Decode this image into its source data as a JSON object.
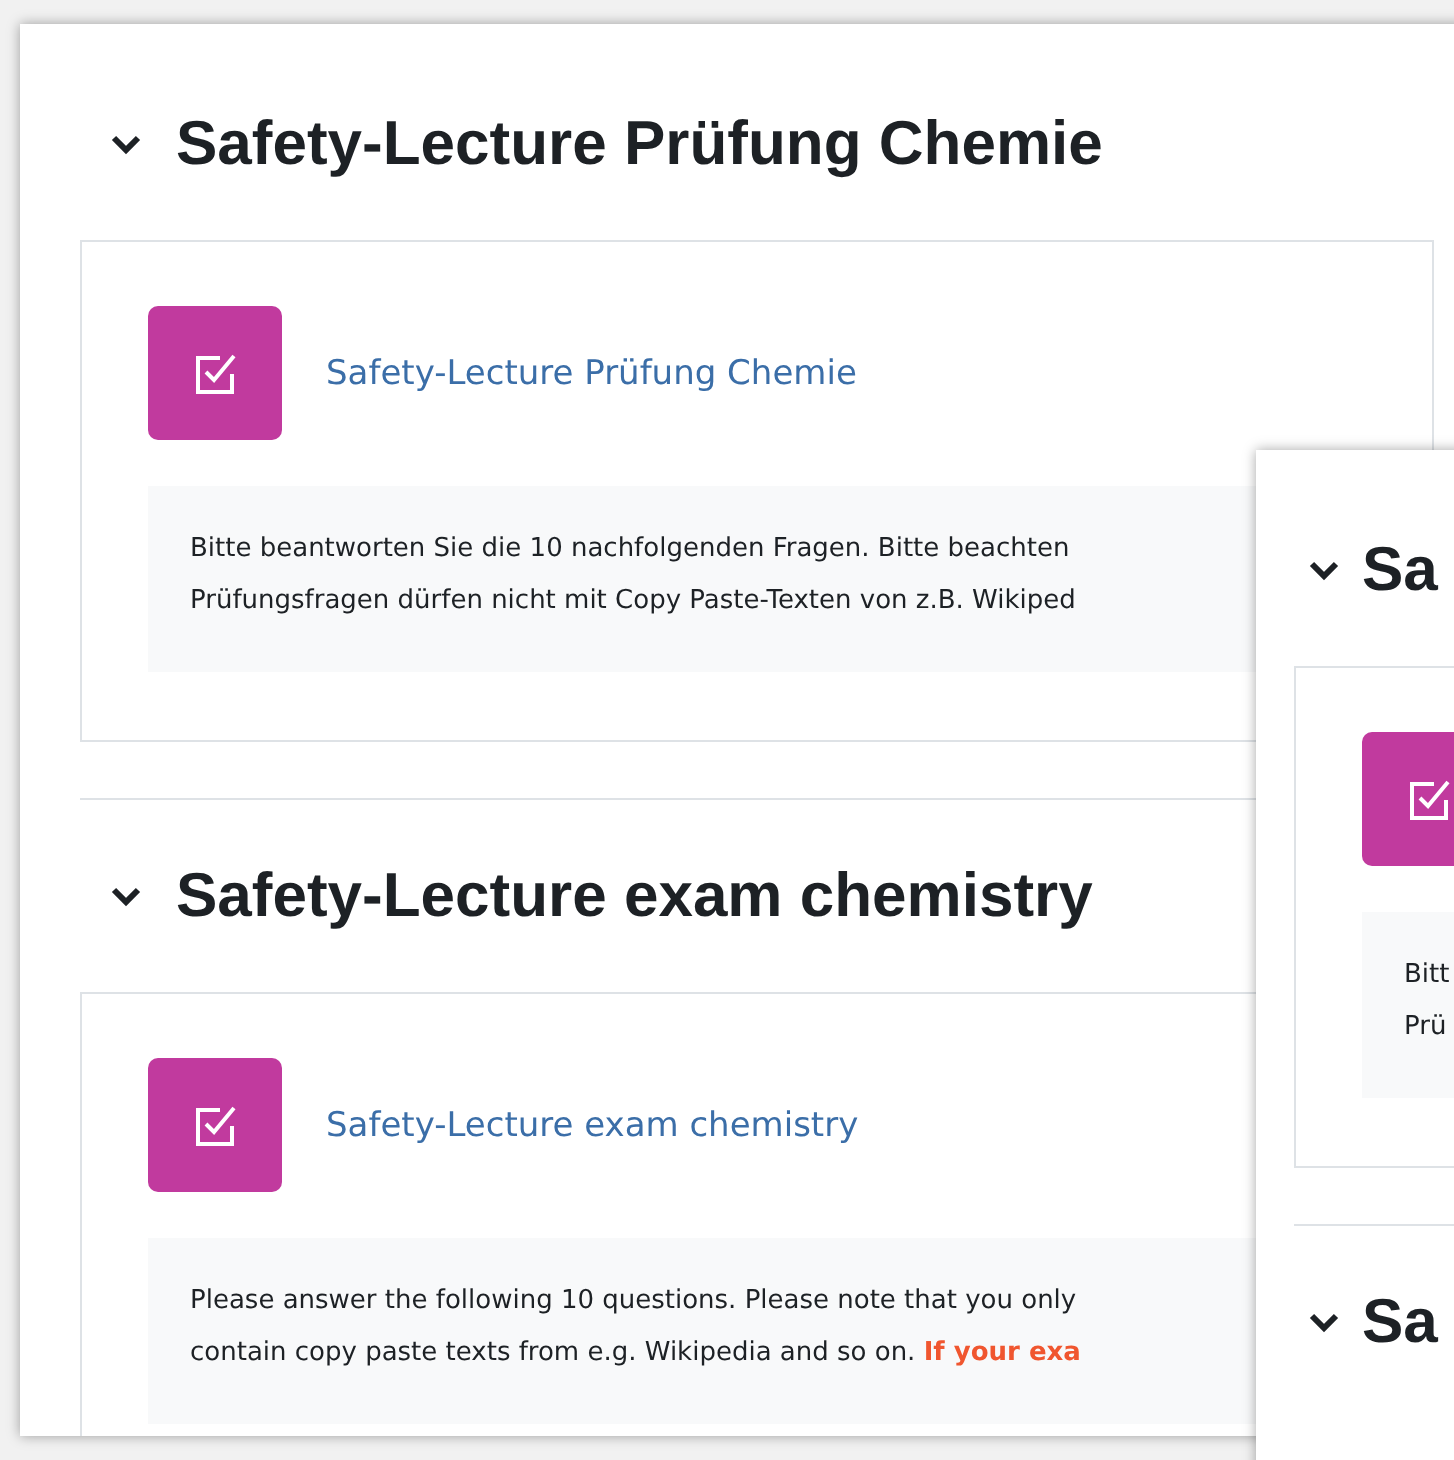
{
  "windows": [
    {
      "sections": [
        {
          "title": "Safety-Lecture Prüfung Chemie",
          "expanded": true,
          "activity": {
            "name": "Safety-Lecture Prüfung Chemie",
            "description": [
              "Bitte beantworten Sie die 10 nachfolgenden Fragen. Bitte beachten",
              "Prüfungsfragen dürfen nicht mit Copy Paste-Texten von z.B. Wikiped"
            ]
          }
        },
        {
          "title": "Safety-Lecture exam chemistry",
          "expanded": true,
          "activity": {
            "name": "Safety-Lecture exam chemistry",
            "description": [
              "Please answer the following 10 questions. Please note that you only",
              "contain copy paste texts from e.g. Wikipedia and so on. **If your exa**"
            ]
          }
        }
      ]
    },
    {
      "sections": [
        {
          "title": "Sa",
          "expanded": true,
          "activity": {
            "description": [
              "Bitt",
              "Prü"
            ]
          }
        },
        {
          "title": "Sa",
          "expanded": true
        }
      ]
    }
  ]
}
